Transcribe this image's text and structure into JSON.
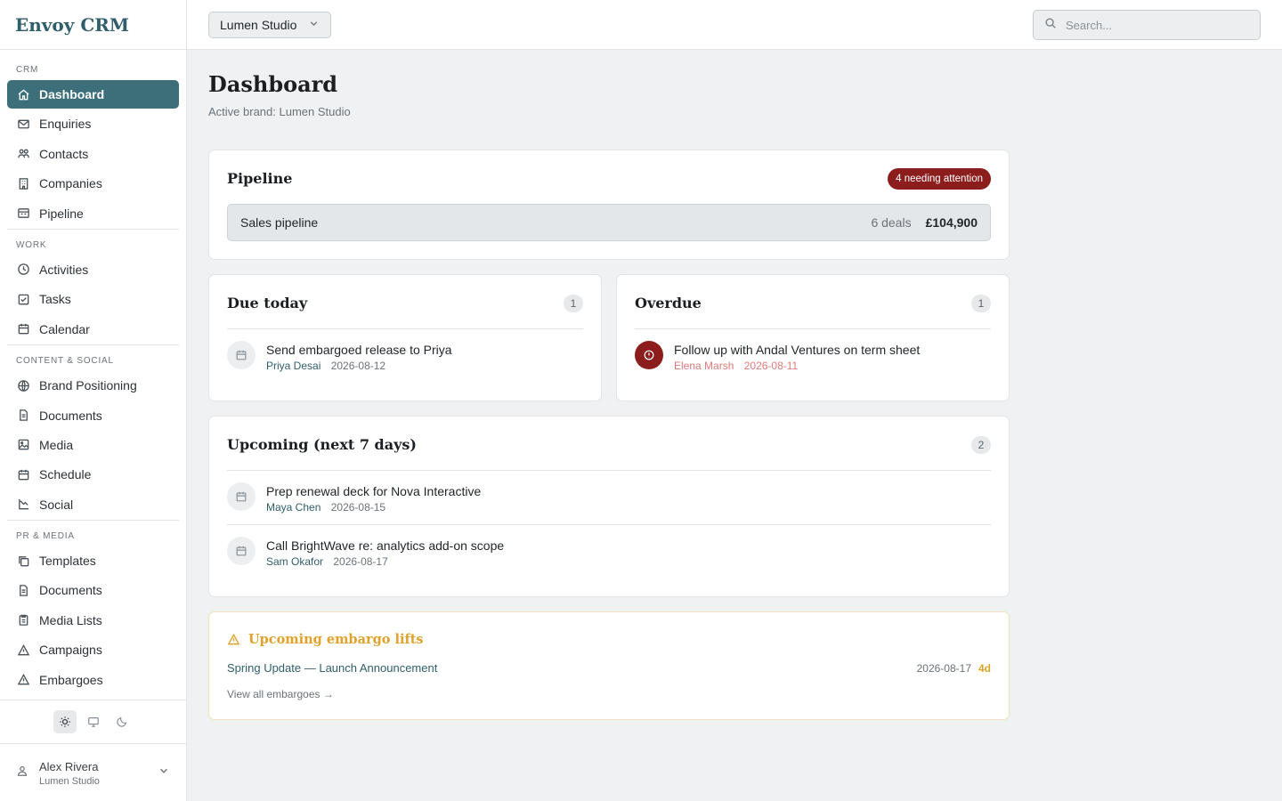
{
  "app": {
    "title": "Envoy CRM"
  },
  "sidebar": {
    "sections": [
      {
        "label": "CRM",
        "items": [
          {
            "label": "Dashboard",
            "icon": "home-icon",
            "active": true
          },
          {
            "label": "Enquiries",
            "icon": "mail-icon"
          },
          {
            "label": "Contacts",
            "icon": "users-icon"
          },
          {
            "label": "Companies",
            "icon": "building-icon"
          },
          {
            "label": "Pipeline",
            "icon": "pipeline-icon"
          }
        ]
      },
      {
        "label": "WORK",
        "items": [
          {
            "label": "Activities",
            "icon": "clock-icon"
          },
          {
            "label": "Tasks",
            "icon": "checkbox-icon"
          },
          {
            "label": "Calendar",
            "icon": "calendar-icon"
          }
        ]
      },
      {
        "label": "CONTENT & SOCIAL",
        "items": [
          {
            "label": "Brand Positioning",
            "icon": "globe-icon"
          },
          {
            "label": "Documents",
            "icon": "document-icon"
          },
          {
            "label": "Media",
            "icon": "image-icon"
          },
          {
            "label": "Schedule",
            "icon": "calendar-icon"
          },
          {
            "label": "Social",
            "icon": "chart-icon"
          }
        ]
      },
      {
        "label": "PR & MEDIA",
        "items": [
          {
            "label": "Templates",
            "icon": "copy-icon"
          },
          {
            "label": "Documents",
            "icon": "document-icon"
          },
          {
            "label": "Media Lists",
            "icon": "clipboard-icon"
          },
          {
            "label": "Campaigns",
            "icon": "triangle-icon"
          },
          {
            "label": "Embargoes",
            "icon": "warning-icon"
          }
        ]
      }
    ],
    "theme": {
      "options": [
        "light",
        "system",
        "dark"
      ],
      "selected": "light"
    },
    "user": {
      "name": "Alex Rivera",
      "brand": "Lumen Studio"
    }
  },
  "topbar": {
    "brand_select": "Lumen Studio",
    "search_placeholder": "Search..."
  },
  "page": {
    "title": "Dashboard",
    "subtitle": "Active brand: Lumen Studio"
  },
  "pipeline": {
    "title": "Pipeline",
    "attention": "4 needing attention",
    "name": "Sales pipeline",
    "deals": "6 deals",
    "amount": "£104,900"
  },
  "due_today": {
    "title": "Due today",
    "count": "1",
    "tasks": [
      {
        "title": "Send embargoed release to Priya",
        "owner": "Priya Desai",
        "date": "2026-08-12"
      }
    ]
  },
  "overdue": {
    "title": "Overdue",
    "count": "1",
    "tasks": [
      {
        "title": "Follow up with Andal Ventures on term sheet",
        "owner": "Elena Marsh",
        "date": "2026-08-11"
      }
    ]
  },
  "upcoming": {
    "title": "Upcoming (next 7 days)",
    "count": "2",
    "tasks": [
      {
        "title": "Prep renewal deck for Nova Interactive",
        "owner": "Maya Chen",
        "date": "2026-08-15"
      },
      {
        "title": "Call BrightWave re: analytics add-on scope",
        "owner": "Sam Okafor",
        "date": "2026-08-17"
      }
    ]
  },
  "embargo": {
    "title": "Upcoming embargo lifts",
    "item": "Spring Update — Launch Announcement",
    "date": "2026-08-17",
    "days": "4d",
    "view_all": "View all embargoes →"
  },
  "colors": {
    "accent": "#3c6f7a",
    "danger": "#8b1d1d",
    "warning": "#e0a22a"
  }
}
